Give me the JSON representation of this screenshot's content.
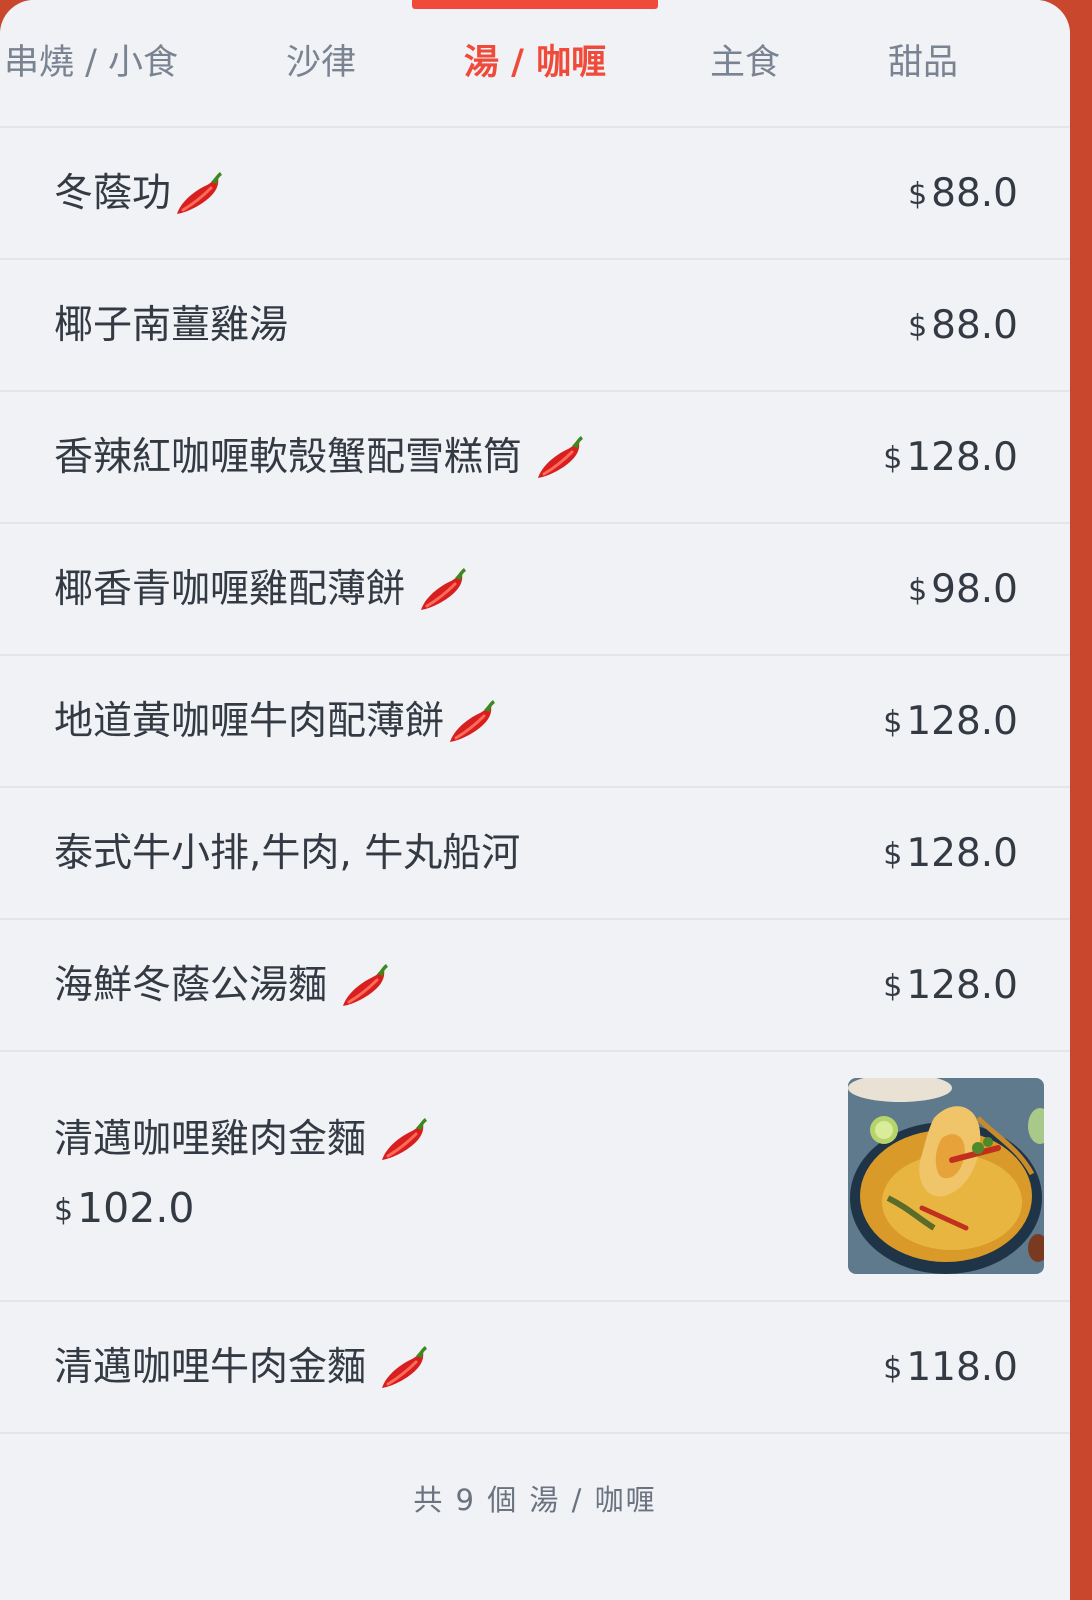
{
  "tabs": {
    "items": [
      {
        "label": "串燒 / 小食"
      },
      {
        "label": "沙律"
      },
      {
        "label": "湯 / 咖喱"
      },
      {
        "label": "主食"
      },
      {
        "label": "甜品"
      }
    ],
    "active_index": 2
  },
  "currency_symbol": "$",
  "menu_items": [
    {
      "name": "冬蔭功",
      "price": "88.0",
      "spicy": true
    },
    {
      "name": "椰子南薑雞湯",
      "price": "88.0",
      "spicy": false
    },
    {
      "name": "香辣紅咖喱軟殼蟹配雪糕筒",
      "price": "128.0",
      "spicy": true
    },
    {
      "name": "椰香青咖喱雞配薄餅",
      "price": "98.0",
      "spicy": true
    },
    {
      "name": "地道黃咖喱牛肉配薄餅",
      "price": "128.0",
      "spicy": true
    },
    {
      "name": "泰式牛小排,牛肉, 牛丸船河",
      "price": "128.0",
      "spicy": false
    },
    {
      "name": "海鮮冬蔭公湯麵",
      "price": "128.0",
      "spicy": true
    },
    {
      "name": "清邁咖哩雞肉金麵",
      "price": "102.0",
      "spicy": true,
      "has_photo": true
    },
    {
      "name": "清邁咖哩牛肉金麵",
      "price": "118.0",
      "spicy": true
    }
  ],
  "footer": {
    "text": "共 9 個 湯 / 咖喱"
  },
  "colors": {
    "accent": "#f04a3a",
    "background": "#f0f2f5",
    "text": "#333a44",
    "muted": "#7a8392"
  },
  "icons": {
    "spicy": "chili-pepper-icon"
  }
}
